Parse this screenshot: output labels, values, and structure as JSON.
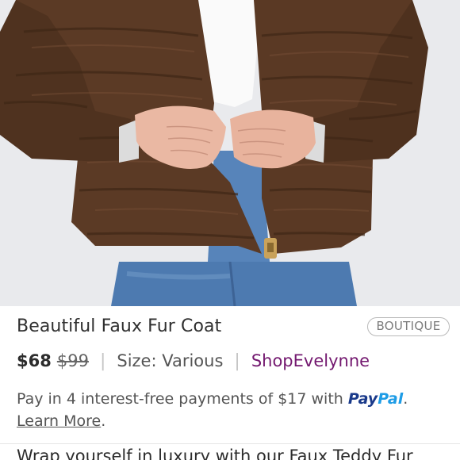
{
  "listing": {
    "image_alt": "brown faux fur coat photo",
    "title": "Beautiful Faux Fur Coat",
    "badge": "BOUTIQUE",
    "price": "$68",
    "original_price": "$99",
    "separator": "|",
    "size_text": "Size: Various",
    "seller": "ShopEvelynne"
  },
  "payment": {
    "text_before": "Pay in 4 interest-free payments of $17 with ",
    "paypal_pay": "Pay",
    "paypal_pal": "Pal",
    "text_after": ".",
    "learn_more": "Learn More",
    "learn_after": "."
  },
  "description": {
    "text": "Wrap yourself in luxury with our Faux Teddy Fur"
  },
  "colors": {
    "seller": "#73186f",
    "paypal_dark": "#1a3a8a",
    "paypal_light": "#1e9ce6",
    "fur": "#5b3a25",
    "denim": "#4d7ab0"
  }
}
